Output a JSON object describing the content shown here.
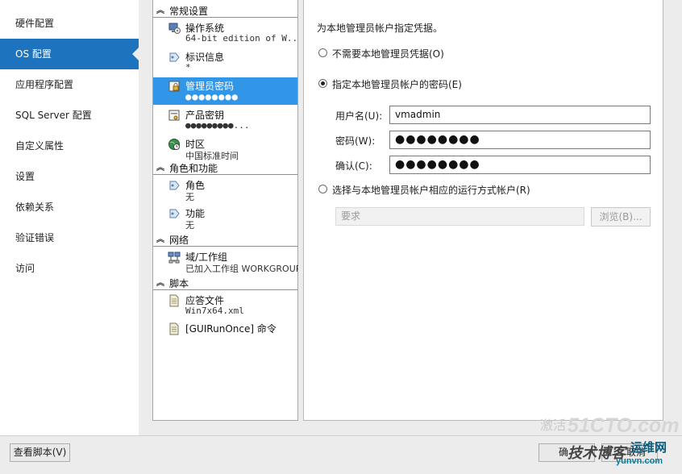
{
  "nav": {
    "items": [
      {
        "label": "硬件配置",
        "active": false
      },
      {
        "label": "OS 配置",
        "active": true
      },
      {
        "label": "应用程序配置",
        "active": false
      },
      {
        "label": "SQL Server 配置",
        "active": false
      },
      {
        "label": "自定义属性",
        "active": false
      },
      {
        "label": "设置",
        "active": false
      },
      {
        "label": "依赖关系",
        "active": false
      },
      {
        "label": "验证错误",
        "active": false
      },
      {
        "label": "访问",
        "active": false
      }
    ]
  },
  "tree": {
    "groups": {
      "general": "常规设置",
      "roles": "角色和功能",
      "network": "网络",
      "scripts": "脚本"
    },
    "items": {
      "os": {
        "title": "操作系统",
        "sub": "64-bit edition of W..."
      },
      "identity": {
        "title": "标识信息",
        "sub": "*"
      },
      "admin_password": {
        "title": "管理员密码",
        "sub": "●●●●●●●●"
      },
      "product_key": {
        "title": "产品密钥",
        "sub": "●●●●●●●●●..."
      },
      "timezone": {
        "title": "时区",
        "sub": "中国标准时间"
      },
      "roles": {
        "title": "角色",
        "sub": "无"
      },
      "features": {
        "title": "功能",
        "sub": "无"
      },
      "domain": {
        "title": "域/工作组",
        "sub": "已加入工作组 WORKGROUP"
      },
      "answer_file": {
        "title": "应答文件",
        "sub": "Win7x64.xml"
      },
      "guirunonce": {
        "title": "[GUIRunOnce] 命令",
        "sub": ""
      }
    }
  },
  "main": {
    "heading": "为本地管理员帐户指定凭据。",
    "radio_none": "不需要本地管理员凭据(O)",
    "radio_password": "指定本地管理员帐户的密码(E)",
    "username_label": "用户名(U):",
    "username_value": "vmadmin",
    "password_label": "密码(W):",
    "password_value": "●●●●●●●●",
    "confirm_label": "确认(C):",
    "confirm_value": "●●●●●●●●",
    "radio_runas": "选择与本地管理员帐户相应的运行方式帐户(R)",
    "runas_placeholder": "要求",
    "browse_label": "浏览(B)..."
  },
  "bottom": {
    "view_script": "查看脚本(V)",
    "ok_partial": "确",
    "cancel_partial": "取消"
  },
  "watermark": {
    "site": "51CTO.com",
    "activate": "激活",
    "blog": "技术博客",
    "yunwei": "运维网",
    "url": "yunvn.com"
  }
}
